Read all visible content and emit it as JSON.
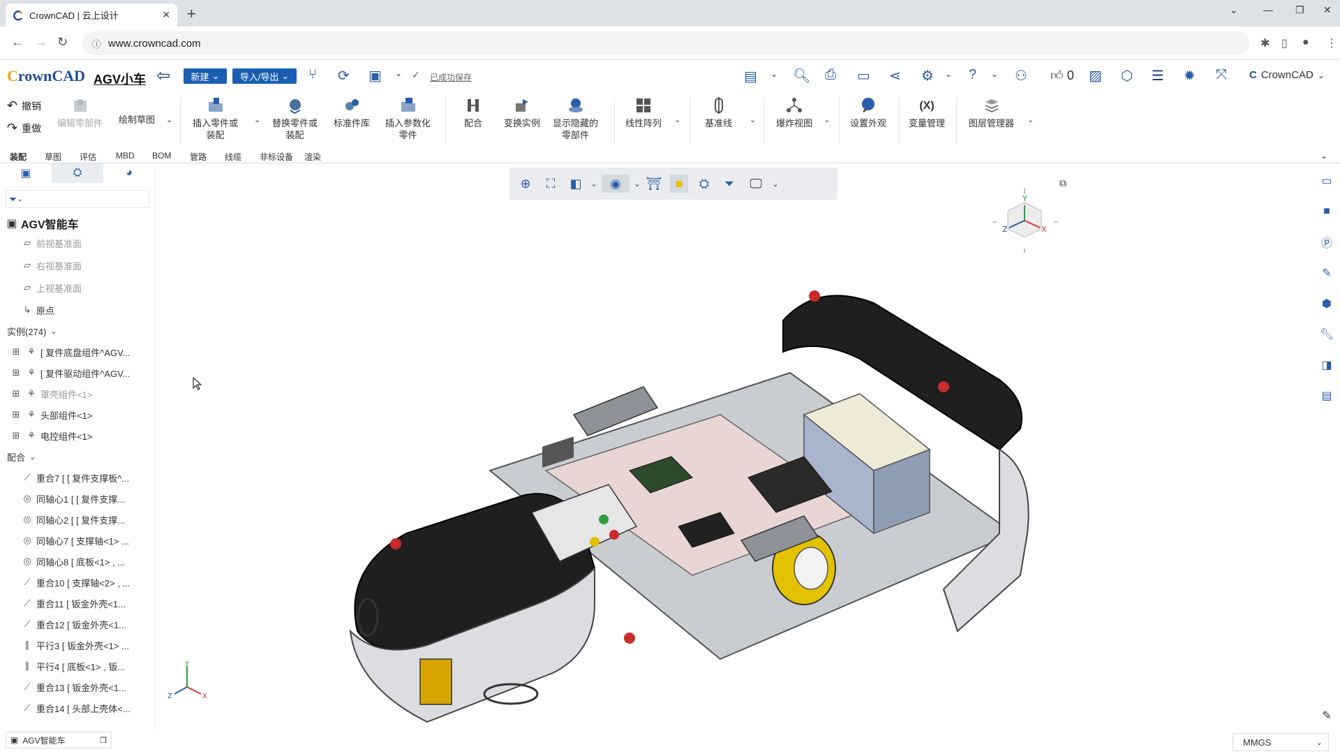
{
  "browser": {
    "tab_title": "CrownCAD | 云上设计",
    "url": "www.crowncad.com"
  },
  "app": {
    "logo_main": "rownCAD",
    "logo_c": "C",
    "doc_title": "AGV小车",
    "btn_new": "新建",
    "btn_import_export": "导入/导出",
    "saved_status": "已成功保存",
    "likes": "0",
    "user_name": "CrownCAD"
  },
  "ribbon": {
    "undo": "撤销",
    "redo": "重做",
    "edit_part": "编辑零部件",
    "sketch": "绘制草图",
    "insert_part_l1": "插入零件或",
    "insert_part_l2": "装配",
    "replace_part_l1": "替换零件或",
    "replace_part_l2": "装配",
    "std_lib": "标准件库",
    "insert_param_l1": "插入参数化",
    "insert_param_l2": "零件",
    "mate": "配合",
    "transform": "变换实例",
    "show_hidden_l1": "显示隐藏的",
    "show_hidden_l2": "零部件",
    "linear_pattern": "线性阵列",
    "datum_line": "基准线",
    "explode": "爆炸视图",
    "appearance": "设置外观",
    "var_mgr": "变量管理",
    "var_icon": "(X)",
    "layer_mgr": "图层管理器"
  },
  "mode_tabs": [
    "装配",
    "草图",
    "评估",
    "MBD",
    "BOM",
    "管路",
    "线缆",
    "非标设备",
    "渲染"
  ],
  "tree": {
    "root": "AGV智能车",
    "planes": [
      "前视基准面",
      "右视基准面",
      "上视基准面"
    ],
    "origin": "原点",
    "instances_label": "实例(274)",
    "instances": [
      "[ 复件底盘组件^AGV...",
      "[ 复件驱动组件^AGV...",
      "罩壳组件<1>",
      "头部组件<1>",
      "电控组件<1>"
    ],
    "mates_label": "配合",
    "mates": [
      "重合7 [ [ 复件支撑板^...",
      "同轴心1 [ [ 复件支撑...",
      "同轴心2 [ [ 复件支撑...",
      "同轴心7 [ 支撑轴<1> ...",
      "同轴心8 [ 底板<1> , ...",
      "重合10 [ 支撑轴<2> , ...",
      "重合11 [ 钣金外壳<1...",
      "重合12 [ 钣金外壳<1...",
      "平行3 [ 钣金外壳<1> ...",
      "平行4 [ 底板<1> , 钣...",
      "重合13 [ 钣金外壳<1...",
      "重合14 [ 头部上壳体<..."
    ]
  },
  "bottom": {
    "doc_tab": "AGV智能车",
    "units": "MMGS"
  },
  "triad": {
    "x": "X",
    "y": "Y",
    "z": "Z"
  }
}
